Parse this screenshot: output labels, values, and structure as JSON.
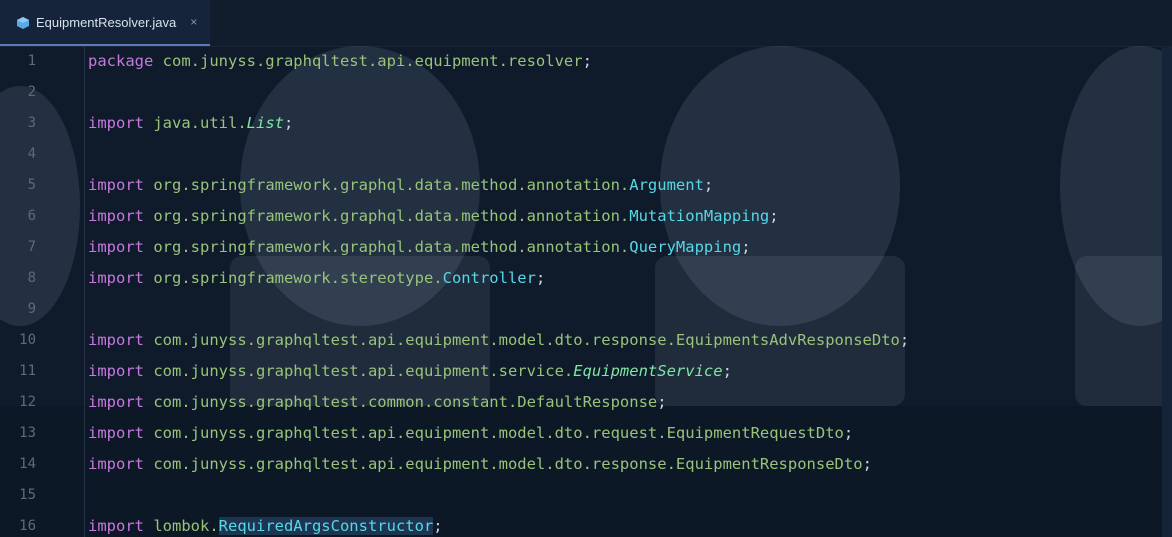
{
  "tab": {
    "title": "EquipmentResolver.java",
    "close_glyph": "×",
    "icon": "java-file-icon",
    "icon_color": "#5aa9e6"
  },
  "colors": {
    "keyword": "#c678dd",
    "package": "#98c379",
    "class": "#56d8e6",
    "italic_type": "#7fe7a4",
    "background": "#0f1b2b"
  },
  "lines": [
    {
      "n": "1",
      "kw": "package",
      "pkg": " com.junyss.graphqltest.api.equipment.resolver",
      "cls": "",
      "italic": "",
      "end": ";"
    },
    {
      "n": "2",
      "kw": "",
      "pkg": "",
      "cls": "",
      "italic": "",
      "end": ""
    },
    {
      "n": "3",
      "kw": "import",
      "pkg": " java.util.",
      "cls": "",
      "italic": "List",
      "end": ";"
    },
    {
      "n": "4",
      "kw": "",
      "pkg": "",
      "cls": "",
      "italic": "",
      "end": ""
    },
    {
      "n": "5",
      "kw": "import",
      "pkg": " org.springframework.graphql.data.method.annotation.",
      "cls": "Argument",
      "italic": "",
      "end": ";"
    },
    {
      "n": "6",
      "kw": "import",
      "pkg": " org.springframework.graphql.data.method.annotation.",
      "cls": "MutationMapping",
      "italic": "",
      "end": ";"
    },
    {
      "n": "7",
      "kw": "import",
      "pkg": " org.springframework.graphql.data.method.annotation.",
      "cls": "QueryMapping",
      "italic": "",
      "end": ";"
    },
    {
      "n": "8",
      "kw": "import",
      "pkg": " org.springframework.stereotype.",
      "cls": "Controller",
      "italic": "",
      "end": ";"
    },
    {
      "n": "9",
      "kw": "",
      "pkg": "",
      "cls": "",
      "italic": "",
      "end": ""
    },
    {
      "n": "10",
      "kw": "import",
      "pkg": " com.junyss.graphqltest.api.equipment.model.dto.response.EquipmentsAdvResponseDto",
      "cls": "",
      "italic": "",
      "end": ";"
    },
    {
      "n": "11",
      "kw": "import",
      "pkg": " com.junyss.graphqltest.api.equipment.service.",
      "cls": "",
      "italic": "EquipmentService",
      "end": ";"
    },
    {
      "n": "12",
      "kw": "import",
      "pkg": " com.junyss.graphqltest.common.constant.DefaultResponse",
      "cls": "",
      "italic": "",
      "end": ";"
    },
    {
      "n": "13",
      "kw": "import",
      "pkg": " com.junyss.graphqltest.api.equipment.model.dto.request.EquipmentRequestDto",
      "cls": "",
      "italic": "",
      "end": ";"
    },
    {
      "n": "14",
      "kw": "import",
      "pkg": " com.junyss.graphqltest.api.equipment.model.dto.response.EquipmentResponseDto",
      "cls": "",
      "italic": "",
      "end": ";"
    },
    {
      "n": "15",
      "kw": "",
      "pkg": "",
      "cls": "",
      "italic": "",
      "end": ""
    },
    {
      "n": "16",
      "kw": "import",
      "pkg": " lombok.",
      "cls": "RequiredArgsConstructor",
      "italic": "",
      "end": ";"
    }
  ]
}
